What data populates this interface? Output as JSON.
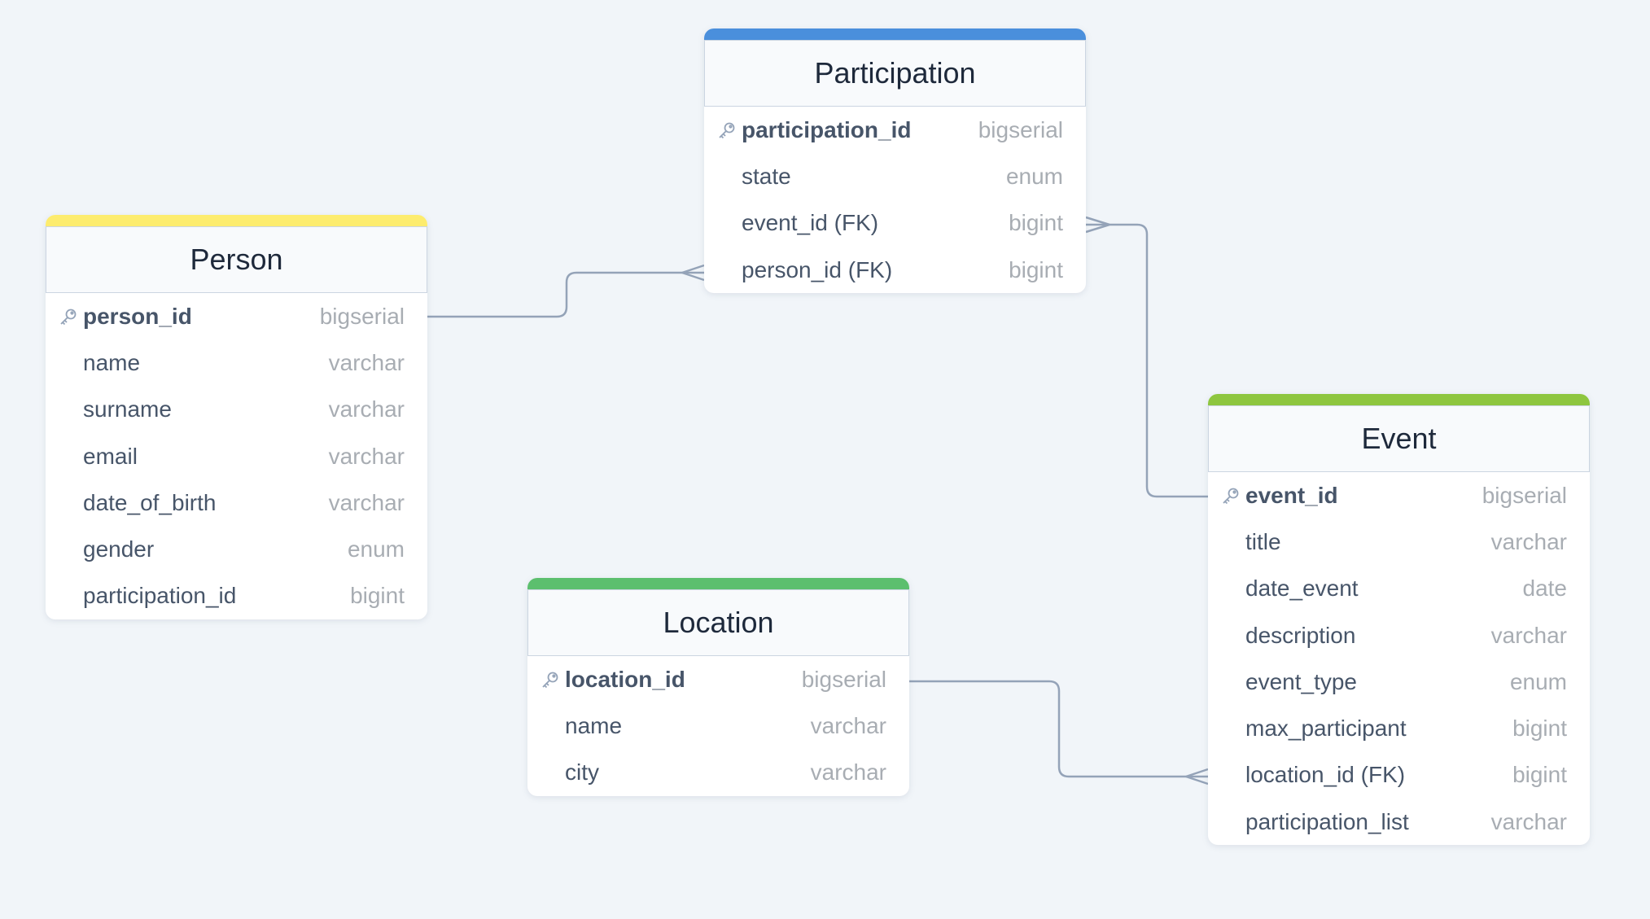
{
  "tables": [
    {
      "id": "person",
      "title": "Person",
      "color": "#fdec6e",
      "fields": [
        {
          "name": "person_id",
          "type": "bigserial",
          "pk": true
        },
        {
          "name": "name",
          "type": "varchar"
        },
        {
          "name": "surname",
          "type": "varchar"
        },
        {
          "name": "email",
          "type": "varchar"
        },
        {
          "name": "date_of_birth",
          "type": "varchar"
        },
        {
          "name": "gender",
          "type": "enum"
        },
        {
          "name": "participation_id",
          "type": "bigint"
        }
      ]
    },
    {
      "id": "participation",
      "title": "Participation",
      "color": "#4a8fdc",
      "fields": [
        {
          "name": "participation_id",
          "type": "bigserial",
          "pk": true
        },
        {
          "name": "state",
          "type": "enum"
        },
        {
          "name": "event_id (FK)",
          "type": "bigint"
        },
        {
          "name": "person_id (FK)",
          "type": "bigint"
        }
      ]
    },
    {
      "id": "event",
      "title": "Event",
      "color": "#8ec63f",
      "fields": [
        {
          "name": "event_id",
          "type": "bigserial",
          "pk": true
        },
        {
          "name": "title",
          "type": "varchar"
        },
        {
          "name": "date_event",
          "type": "date"
        },
        {
          "name": "description",
          "type": "varchar"
        },
        {
          "name": "event_type",
          "type": "enum"
        },
        {
          "name": "max_participant",
          "type": "bigint"
        },
        {
          "name": "location_id (FK)",
          "type": "bigint"
        },
        {
          "name": "participation_list",
          "type": "varchar"
        }
      ]
    },
    {
      "id": "location",
      "title": "Location",
      "color": "#5cbf6e",
      "fields": [
        {
          "name": "location_id",
          "type": "bigserial",
          "pk": true
        },
        {
          "name": "name",
          "type": "varchar"
        },
        {
          "name": "city",
          "type": "varchar"
        }
      ]
    }
  ],
  "relations": [
    {
      "from": "person.person_id",
      "to": "participation.person_id (FK)",
      "cardinality": "one-to-many"
    },
    {
      "from": "event.event_id",
      "to": "participation.event_id (FK)",
      "cardinality": "one-to-many"
    },
    {
      "from": "location.location_id",
      "to": "event.location_id (FK)",
      "cardinality": "one-to-many"
    }
  ],
  "line_color": "#94a3b8"
}
